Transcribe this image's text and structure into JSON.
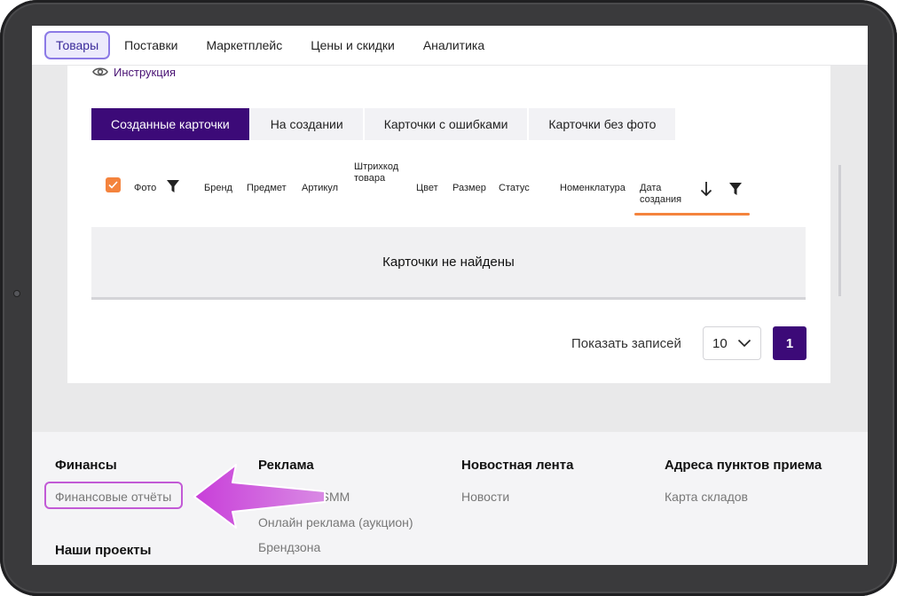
{
  "nav": {
    "items": [
      {
        "label": "Товары",
        "active": true
      },
      {
        "label": "Поставки"
      },
      {
        "label": "Маркетплейс"
      },
      {
        "label": "Цены и скидки"
      },
      {
        "label": "Аналитика"
      }
    ]
  },
  "instruction": {
    "label": "Инструкция",
    "icon": "eye-icon"
  },
  "tabs": [
    {
      "label": "Созданные карточки",
      "active": true
    },
    {
      "label": "На создании"
    },
    {
      "label": "Карточки с ошибками"
    },
    {
      "label": "Карточки без фото"
    }
  ],
  "table": {
    "columns": {
      "photo": "Фото",
      "brand": "Бренд",
      "subject": "Предмет",
      "article": "Артикул",
      "barcode_line1": "Штрихкод",
      "barcode_line2": "товара",
      "color": "Цвет",
      "size": "Размер",
      "status": "Статус",
      "nomenclature": "Номенклатура",
      "date_line1": "Дата",
      "date_line2": "создания"
    },
    "empty_message": "Карточки не найдены"
  },
  "pager": {
    "label": "Показать записей",
    "page_size": "10",
    "current_page": "1"
  },
  "footer": {
    "finance": {
      "title": "Финансы",
      "links": [
        "Финансовые отчёты"
      ]
    },
    "projects": {
      "title": "Наши проекты"
    },
    "ads": {
      "title": "Реклама",
      "links": [
        "Рассылки, SMM",
        "Онлайн реклама (аукцион)",
        "Брендзона"
      ]
    },
    "news": {
      "title": "Новостная лента",
      "links": [
        "Новости"
      ]
    },
    "addresses": {
      "title": "Адреса пунктов приема",
      "links": [
        "Карта складов"
      ]
    }
  },
  "colors": {
    "accent": "#3c0a78",
    "orange": "#f4833d",
    "annotation": "#c25ad6"
  }
}
